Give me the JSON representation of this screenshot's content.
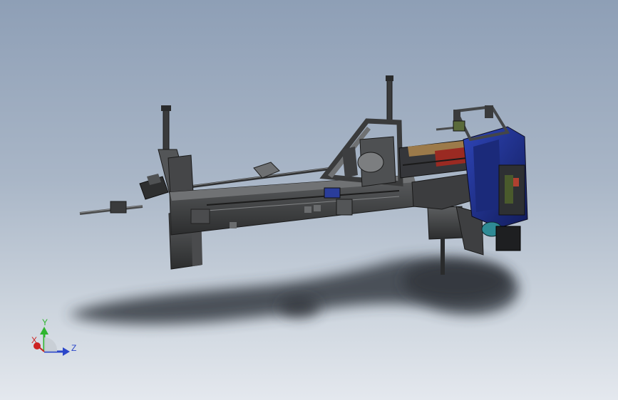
{
  "viewport": {
    "background_top": "#8e9fb6",
    "background_bottom": "#e4e8ee"
  },
  "model": {
    "frame_color": "#3a3b3c",
    "frame_highlight": "#6a6c6e",
    "drive_unit_color": "#1f2f8c",
    "accent_red": "#9a2a22",
    "accent_wood": "#9c7a4a",
    "accent_teal": "#2f8a95",
    "shadow_color": "#353a42"
  },
  "triad": {
    "y_label": "Y",
    "x_label": "X",
    "z_label": "Z",
    "y_color": "#2fb52f",
    "x_color": "#cc2222",
    "z_color": "#2b46c9"
  }
}
